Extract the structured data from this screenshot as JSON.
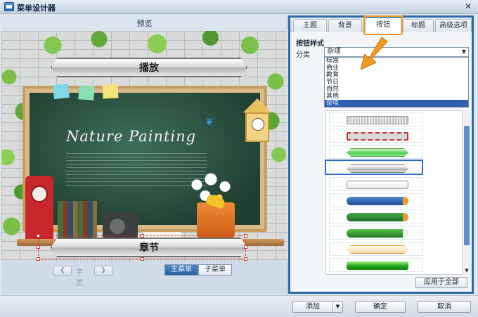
{
  "window": {
    "title": "菜单设计器",
    "close_glyph": "✕"
  },
  "preview": {
    "header": "预览",
    "decor_title": "Nature Painting",
    "play_button_label": "播放",
    "chapter_button_label": "章节",
    "pager": {
      "prev_glyph": "❮",
      "label": "子页",
      "next_glyph": "❯"
    },
    "menu_switch": {
      "main_label": "主菜单",
      "sub_label": "子菜单",
      "active": "main"
    }
  },
  "settings": {
    "tabs": [
      {
        "label": "主题",
        "active": false
      },
      {
        "label": "背景",
        "active": false
      },
      {
        "label": "按钮",
        "active": true
      },
      {
        "label": "标题",
        "active": false
      },
      {
        "label": "高级选项",
        "active": false
      }
    ],
    "section_title": "按钮样式",
    "category_label": "分类",
    "category_selected": "杂项",
    "category_options": [
      {
        "label": "标准",
        "selected": false
      },
      {
        "label": "商业",
        "selected": false
      },
      {
        "label": "教育",
        "selected": false
      },
      {
        "label": "节日",
        "selected": false
      },
      {
        "label": "自然",
        "selected": false
      },
      {
        "label": "其他",
        "selected": false
      },
      {
        "label": "杂项",
        "selected": true
      }
    ],
    "style_count": 10,
    "selected_style_index": 3,
    "apply_all_label": "应用于全部"
  },
  "footer": {
    "add_label": "添加",
    "ok_label": "确定",
    "cancel_label": "取消"
  },
  "colors": {
    "accent": "#2d6aa6",
    "highlight": "#f39a1e",
    "selection": "#2f6cc3",
    "dropdown_selected": "#2f5fb0"
  }
}
